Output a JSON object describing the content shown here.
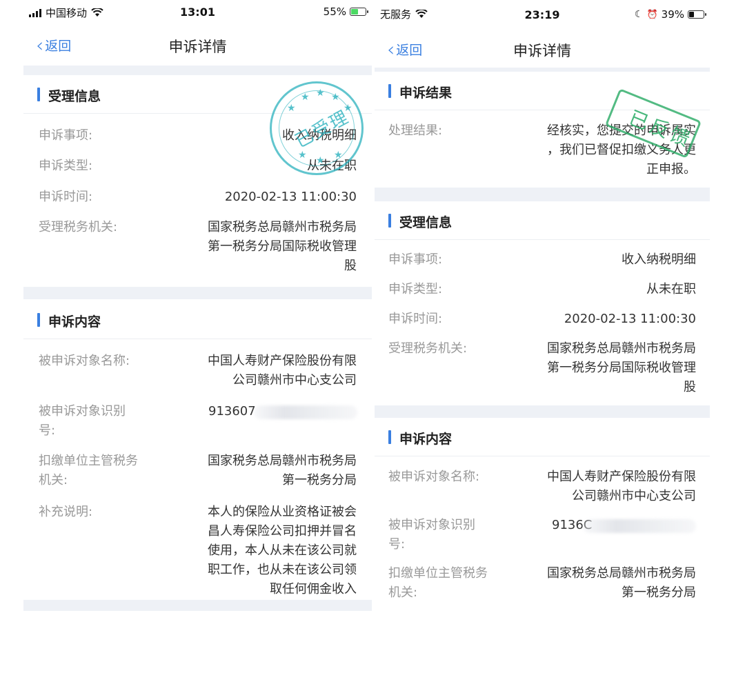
{
  "left": {
    "status_bar": {
      "carrier": "中国移动",
      "time": "13:01",
      "battery": "55%",
      "battery_level": 0.55,
      "battery_color": "#4cd964"
    },
    "nav": {
      "back_label": "返回",
      "title": "申诉详情"
    },
    "accept_section": {
      "title": "受理信息",
      "rows": [
        {
          "label": "申诉事项:",
          "value": "收入纳税明细"
        },
        {
          "label": "申诉类型:",
          "value": "从未在职"
        },
        {
          "label": "申诉时间:",
          "value": "2020-02-13 11:00:30"
        },
        {
          "label": "受理税务机关:",
          "value_lines": [
            "国家税务总局赣州市税务局",
            "第一税务分局国际税收管理",
            "股"
          ]
        }
      ]
    },
    "content_section": {
      "title": "申诉内容",
      "rows": [
        {
          "label": "被申诉对象名称:",
          "value_lines": [
            "中国人寿财产保险股份有限",
            "公司赣州市中心支公司"
          ]
        },
        {
          "label_lines": [
            "被申诉对象识别",
            "号:"
          ],
          "value": "913607"
        },
        {
          "label_lines": [
            "扣缴单位主管税务",
            "机关:"
          ],
          "value_lines": [
            "国家税务总局赣州市税务局",
            "第一税务分局"
          ]
        },
        {
          "label": "补充说明:",
          "value_lines": [
            "本人的保险从业资格证被会",
            "昌人寿保险公司扣押并冒名",
            "使用，本人从未在该公司就",
            "职工作，也从未在该公司领",
            "取任何佣金收入"
          ]
        }
      ]
    },
    "stamp": {
      "text": "已受理",
      "color": "#2cb2be"
    }
  },
  "right": {
    "status_bar": {
      "carrier": "无服务",
      "time": "23:19",
      "battery": "39%",
      "battery_level": 0.39,
      "battery_color": "#111111"
    },
    "nav": {
      "back_label": "返回",
      "title": "申诉详情"
    },
    "result_section": {
      "title": "申诉结果",
      "rows": [
        {
          "label": "处理结果:",
          "value_lines": [
            "经核实，您提交的申诉属实",
            "，我们已督促扣缴义务人更",
            "正申报。"
          ]
        }
      ]
    },
    "accept_section": {
      "title": "受理信息",
      "rows": [
        {
          "label": "申诉事项:",
          "value": "收入纳税明细"
        },
        {
          "label": "申诉类型:",
          "value": "从未在职"
        },
        {
          "label": "申诉时间:",
          "value": "2020-02-13 11:00:30"
        },
        {
          "label": "受理税务机关:",
          "value_lines": [
            "国家税务总局赣州市税务局",
            "第一税务分局国际税收管理",
            "股"
          ]
        }
      ]
    },
    "content_section": {
      "title": "申诉内容",
      "rows": [
        {
          "label": "被申诉对象名称:",
          "value_lines": [
            "中国人寿财产保险股份有限",
            "公司赣州市中心支公司"
          ]
        },
        {
          "label_lines": [
            "被申诉对象识别",
            "号:"
          ],
          "value": "9136C"
        },
        {
          "label_lines": [
            "扣缴单位主管税务",
            "机关:"
          ],
          "value_lines": [
            "国家税务总局赣州市税务局",
            "第一税务分局"
          ]
        }
      ]
    },
    "stamp": {
      "text": "已反馈",
      "color": "#28aa64"
    }
  }
}
